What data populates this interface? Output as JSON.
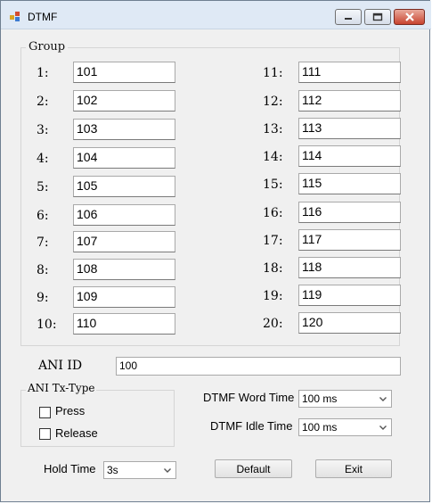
{
  "window": {
    "title": "DTMF"
  },
  "group": {
    "label": "Group",
    "left_rows": [
      {
        "label": "1:",
        "value": "101"
      },
      {
        "label": "2:",
        "value": "102"
      },
      {
        "label": "3:",
        "value": "103"
      },
      {
        "label": "4:",
        "value": "104"
      },
      {
        "label": "5:",
        "value": "105"
      },
      {
        "label": "6:",
        "value": "106"
      },
      {
        "label": "7:",
        "value": "107"
      },
      {
        "label": "8:",
        "value": "108"
      },
      {
        "label": "9:",
        "value": "109"
      },
      {
        "label": "10:",
        "value": "110"
      }
    ],
    "right_rows": [
      {
        "label": "11:",
        "value": "111"
      },
      {
        "label": "12:",
        "value": "112"
      },
      {
        "label": "13:",
        "value": "113"
      },
      {
        "label": "14:",
        "value": "114"
      },
      {
        "label": "15:",
        "value": "115"
      },
      {
        "label": "16:",
        "value": "116"
      },
      {
        "label": "17:",
        "value": "117"
      },
      {
        "label": "18:",
        "value": "118"
      },
      {
        "label": "19:",
        "value": "119"
      },
      {
        "label": "20:",
        "value": "120"
      }
    ]
  },
  "ani": {
    "label": "ANI ID",
    "value": "100"
  },
  "tx_type": {
    "label": "ANI Tx-Type",
    "press": {
      "label": "Press",
      "checked": false
    },
    "release": {
      "label": "Release",
      "checked": false
    }
  },
  "word_time": {
    "label": "DTMF Word Time",
    "value": "100 ms"
  },
  "idle_time": {
    "label": "DTMF Idle Time",
    "value": "100 ms"
  },
  "hold_time": {
    "label": "Hold Time",
    "value": "3s"
  },
  "buttons": {
    "default": "Default",
    "exit": "Exit"
  },
  "icons": {
    "app": "dtmf-app-icon",
    "minimize": "minimize-icon",
    "maximize": "maximize-icon",
    "close": "close-icon",
    "dropdown": "chevron-down-icon"
  }
}
